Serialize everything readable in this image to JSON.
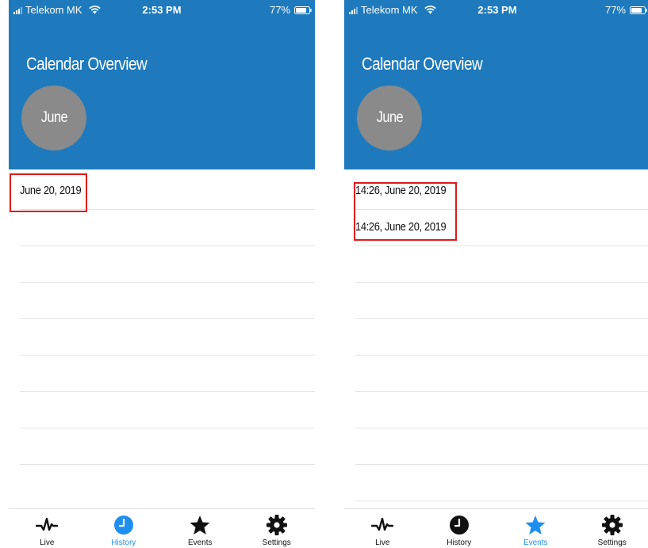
{
  "status_bar": {
    "carrier": "Telekom MK",
    "time": "2:53 PM",
    "battery": "77%"
  },
  "app": {
    "title": "Calendar Overview",
    "month": "June"
  },
  "screens": {
    "left": {
      "rows": [
        "June 20, 2019",
        "",
        "",
        "",
        "",
        "",
        "",
        "",
        ""
      ],
      "active_tab": "History"
    },
    "right": {
      "rows": [
        "14:26, June 20, 2019",
        "14:26, June 20, 2019",
        "",
        "",
        "",
        "",
        "",
        "",
        ""
      ],
      "active_tab": "Events"
    }
  },
  "tabs": [
    {
      "label": "Live",
      "icon": "pulse-icon"
    },
    {
      "label": "History",
      "icon": "clock-icon"
    },
    {
      "label": "Events",
      "icon": "star-icon"
    },
    {
      "label": "Settings",
      "icon": "gear-icon"
    }
  ],
  "colors": {
    "header": "#1e7abd",
    "accent": "#1f8ef1",
    "circle": "#8a8a8a",
    "highlight": "#e0181b"
  }
}
